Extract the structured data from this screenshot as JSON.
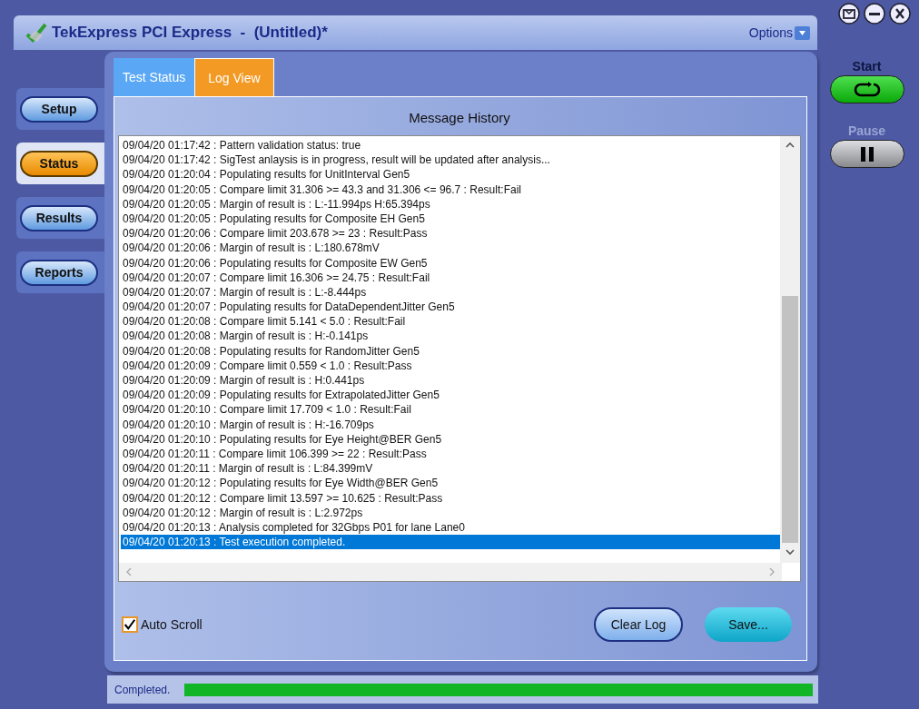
{
  "window": {
    "title": "TekExpress PCI Express  -  (Untitled)*",
    "options_label": "Options"
  },
  "nav": [
    {
      "label": "Setup",
      "selected": false
    },
    {
      "label": "Status",
      "selected": true
    },
    {
      "label": "Results",
      "selected": false
    },
    {
      "label": "Reports",
      "selected": false
    }
  ],
  "controls": [
    {
      "label": "Start",
      "kind": "start",
      "disabled": false
    },
    {
      "label": "Pause",
      "kind": "pause",
      "disabled": true
    }
  ],
  "tabs": [
    {
      "label": "Test Status",
      "selected": false
    },
    {
      "label": "Log View",
      "selected": true
    }
  ],
  "log": {
    "heading": "Message History",
    "lines": [
      {
        "text": "09/04/20 01:17:42 : Pattern validation status: true",
        "selected": false
      },
      {
        "text": "09/04/20 01:17:42 : SigTest anlaysis is in progress, result will be updated after analysis...",
        "selected": false
      },
      {
        "text": "09/04/20 01:20:04 : Populating results for UnitInterval Gen5",
        "selected": false
      },
      {
        "text": "09/04/20 01:20:05 : Compare limit 31.306 >= 43.3 and 31.306 <= 96.7 : Result:Fail",
        "selected": false
      },
      {
        "text": "09/04/20 01:20:05 : Margin of result is : L:-11.994ps H:65.394ps",
        "selected": false
      },
      {
        "text": "09/04/20 01:20:05 : Populating results for Composite EH Gen5",
        "selected": false
      },
      {
        "text": "09/04/20 01:20:06 : Compare limit 203.678 >= 23 : Result:Pass",
        "selected": false
      },
      {
        "text": "09/04/20 01:20:06 : Margin of result is : L:180.678mV",
        "selected": false
      },
      {
        "text": "09/04/20 01:20:06 : Populating results for Composite EW Gen5",
        "selected": false
      },
      {
        "text": "09/04/20 01:20:07 : Compare limit 16.306 >= 24.75 : Result:Fail",
        "selected": false
      },
      {
        "text": "09/04/20 01:20:07 : Margin of result is : L:-8.444ps",
        "selected": false
      },
      {
        "text": "09/04/20 01:20:07 : Populating results for DataDependentJitter Gen5",
        "selected": false
      },
      {
        "text": "09/04/20 01:20:08 : Compare limit 5.141 < 5.0 : Result:Fail",
        "selected": false
      },
      {
        "text": "09/04/20 01:20:08 : Margin of result is : H:-0.141ps",
        "selected": false
      },
      {
        "text": "09/04/20 01:20:08 : Populating results for RandomJitter Gen5",
        "selected": false
      },
      {
        "text": "09/04/20 01:20:09 : Compare limit 0.559 < 1.0 : Result:Pass",
        "selected": false
      },
      {
        "text": "09/04/20 01:20:09 : Margin of result is : H:0.441ps",
        "selected": false
      },
      {
        "text": "09/04/20 01:20:09 : Populating results for ExtrapolatedJitter Gen5",
        "selected": false
      },
      {
        "text": "09/04/20 01:20:10 : Compare limit 17.709 < 1.0 : Result:Fail",
        "selected": false
      },
      {
        "text": "09/04/20 01:20:10 : Margin of result is : H:-16.709ps",
        "selected": false
      },
      {
        "text": "09/04/20 01:20:10 : Populating results for Eye Height@BER Gen5",
        "selected": false
      },
      {
        "text": "09/04/20 01:20:11 : Compare limit 106.399 >= 22 : Result:Pass",
        "selected": false
      },
      {
        "text": "09/04/20 01:20:11 : Margin of result is : L:84.399mV",
        "selected": false
      },
      {
        "text": "09/04/20 01:20:12 : Populating results for Eye Width@BER Gen5",
        "selected": false
      },
      {
        "text": "09/04/20 01:20:12 : Compare limit 13.597 >= 10.625 : Result:Pass",
        "selected": false
      },
      {
        "text": "09/04/20 01:20:12 : Margin of result is : L:2.972ps",
        "selected": false
      },
      {
        "text": "09/04/20 01:20:13 : Analysis completed for 32Gbps P01 for lane Lane0",
        "selected": false
      },
      {
        "text": "09/04/20 01:20:13 : Test execution completed.",
        "selected": true
      }
    ]
  },
  "auto_scroll": {
    "label": "Auto Scroll",
    "checked": true
  },
  "buttons": [
    {
      "label": "Clear Log",
      "kind": "clear"
    },
    {
      "label": "Save...",
      "kind": "save"
    }
  ],
  "status_bar": {
    "text": "Completed.",
    "level": 1
  }
}
